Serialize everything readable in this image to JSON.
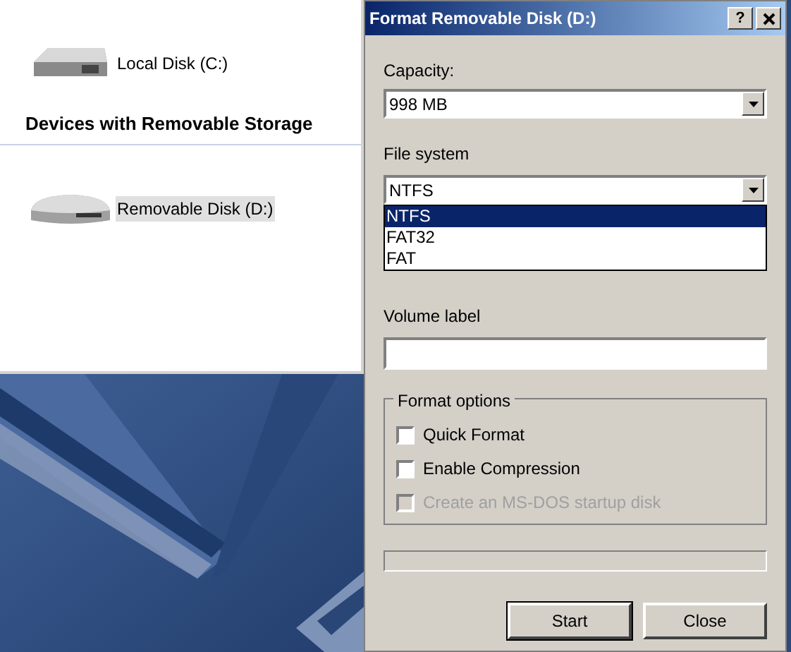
{
  "explorer": {
    "sections": [
      {
        "items": [
          {
            "kind": "hard_disk",
            "label": "Local Disk (C:)",
            "selected": false
          }
        ]
      },
      {
        "title": "Devices with Removable Storage",
        "items": [
          {
            "kind": "removable",
            "label": "Removable Disk (D:)",
            "selected": true
          }
        ]
      }
    ]
  },
  "dialog": {
    "title": "Format Removable Disk (D:)",
    "help": "?",
    "capacity": {
      "label": "Capacity:",
      "value": "998 MB"
    },
    "file_system": {
      "label": "File system",
      "value": "NTFS",
      "expanded": true,
      "options": [
        {
          "label": "NTFS",
          "selected": true
        },
        {
          "label": "FAT32",
          "selected": false
        },
        {
          "label": "FAT",
          "selected": false
        }
      ]
    },
    "volume_label": {
      "label": "Volume label"
    },
    "format_options": {
      "title": "Format options",
      "options": [
        {
          "label": "Quick Format",
          "checked": false,
          "disabled": false
        },
        {
          "label": "Enable Compression",
          "checked": false,
          "disabled": false
        },
        {
          "label": "Create an MS-DOS startup disk",
          "checked": false,
          "disabled": true
        }
      ]
    },
    "progress": {
      "level": 0
    },
    "buttons": [
      "Start",
      "Close"
    ]
  }
}
